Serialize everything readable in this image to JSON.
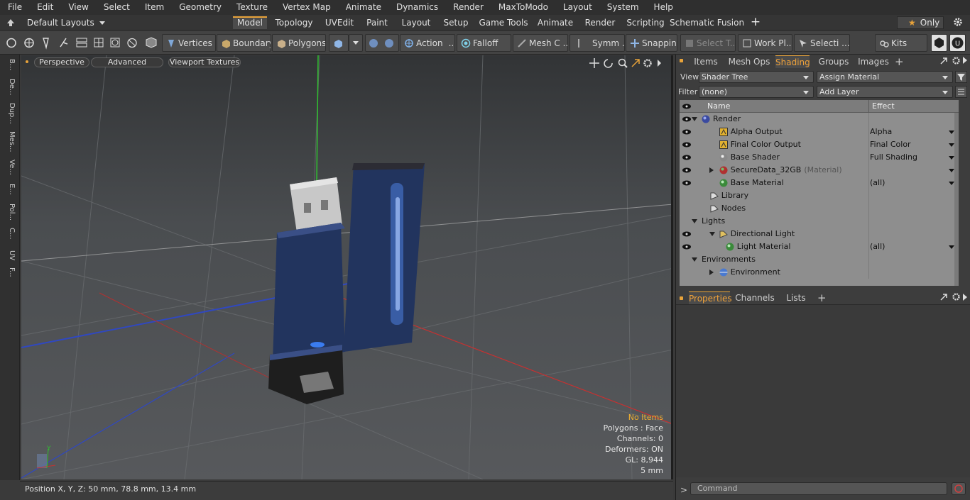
{
  "menubar": {
    "items": [
      "File",
      "Edit",
      "View",
      "Select",
      "Item",
      "Geometry",
      "Texture",
      "Vertex Map",
      "Animate",
      "Dynamics",
      "Render",
      "MaxToModo",
      "Layout",
      "System",
      "Help"
    ]
  },
  "layoutbar": {
    "layouts_label": "Default Layouts",
    "tabs": [
      "Model",
      "Topology",
      "UVEdit",
      "Paint",
      "Layout",
      "Setup",
      "Game Tools",
      "Animate",
      "Render",
      "Scripting",
      "Schematic Fusion"
    ],
    "active_tab": "Model",
    "only_label": "Only"
  },
  "toolbar": {
    "vertices": "Vertices",
    "boundary": "Boundary",
    "polygons": "Polygons",
    "action": "Action",
    "falloff": "Falloff",
    "mesh_c": "Mesh C ...",
    "symm": "Symm ...",
    "snapping": "Snapping",
    "select_t": "Select T...",
    "work_pl": "Work Pl...",
    "selecti": "Selecti ...",
    "kits": "Kits"
  },
  "left_tabs": [
    "B...",
    "De...",
    "Dup...",
    "Mes...",
    "Ve...",
    "E...",
    "Pol...",
    "C...",
    "UV",
    "F..."
  ],
  "viewport": {
    "perspective": "Perspective",
    "advanced": "Advanced",
    "textures": "Viewport Textures",
    "info": {
      "items": "No Items",
      "polygons": "Polygons : Face",
      "channels": "Channels: 0",
      "deformers": "Deformers: ON",
      "gl": "GL: 8,944",
      "scale": "5 mm"
    },
    "axis_y": "Y"
  },
  "status": {
    "position": "Position X, Y, Z:   50 mm, 78.8 mm, 13.4 mm"
  },
  "shading": {
    "tabs": [
      "Items",
      "Mesh Ops",
      "Shading",
      "Groups",
      "Images"
    ],
    "active_tab": "Shading",
    "view_label": "View",
    "view_value": "Shader Tree",
    "assign_material": "Assign Material",
    "filter_label": "Filter",
    "filter_value": "(none)",
    "add_layer": "Add Layer",
    "col_name": "Name",
    "col_effect": "Effect",
    "rows": [
      {
        "name": "Render",
        "effect": "",
        "depth": 0,
        "eye": true,
        "icon": "sphere-blue",
        "expanded": true
      },
      {
        "name": "Alpha Output",
        "effect": "Alpha",
        "depth": 1,
        "eye": true,
        "icon": "output"
      },
      {
        "name": "Final Color Output",
        "effect": "Final Color",
        "depth": 1,
        "eye": true,
        "icon": "output"
      },
      {
        "name": "Base Shader",
        "effect": "Full Shading",
        "depth": 1,
        "eye": true,
        "icon": "sphere-gray"
      },
      {
        "name": "SecureData_32GB",
        "suffix": "(Material)",
        "effect": "",
        "depth": 1,
        "eye": true,
        "icon": "sphere-red",
        "collapsed": true
      },
      {
        "name": "Base Material",
        "effect": "(all)",
        "depth": 1,
        "eye": true,
        "icon": "sphere-green"
      },
      {
        "name": "Library",
        "effect": "",
        "depth": 0.5,
        "eye": false,
        "icon": "folder"
      },
      {
        "name": "Nodes",
        "effect": "",
        "depth": 0.5,
        "eye": false,
        "icon": "folder"
      },
      {
        "name": "Lights",
        "effect": "",
        "depth": 0,
        "eye": false,
        "icon": "none",
        "expanded": true
      },
      {
        "name": "Directional Light",
        "effect": "",
        "depth": 1,
        "eye": true,
        "icon": "light",
        "expanded": true
      },
      {
        "name": "Light Material",
        "effect": "(all)",
        "depth": 2,
        "eye": true,
        "icon": "sphere-green"
      },
      {
        "name": "Environments",
        "effect": "",
        "depth": 0,
        "eye": false,
        "icon": "none",
        "expanded": true
      },
      {
        "name": "Environment",
        "effect": "",
        "depth": 1,
        "eye": false,
        "icon": "globe",
        "collapsed": true
      }
    ]
  },
  "properties": {
    "tabs": [
      "Properties",
      "Channels",
      "Lists"
    ],
    "active_tab": "Properties"
  },
  "command": {
    "placeholder": "Command"
  },
  "colors": {
    "accent": "#e8a33a",
    "usb_body": "#22345e",
    "x_axis": "#c83030",
    "z_axis": "#3048c0",
    "y_axis": "#30c030"
  }
}
